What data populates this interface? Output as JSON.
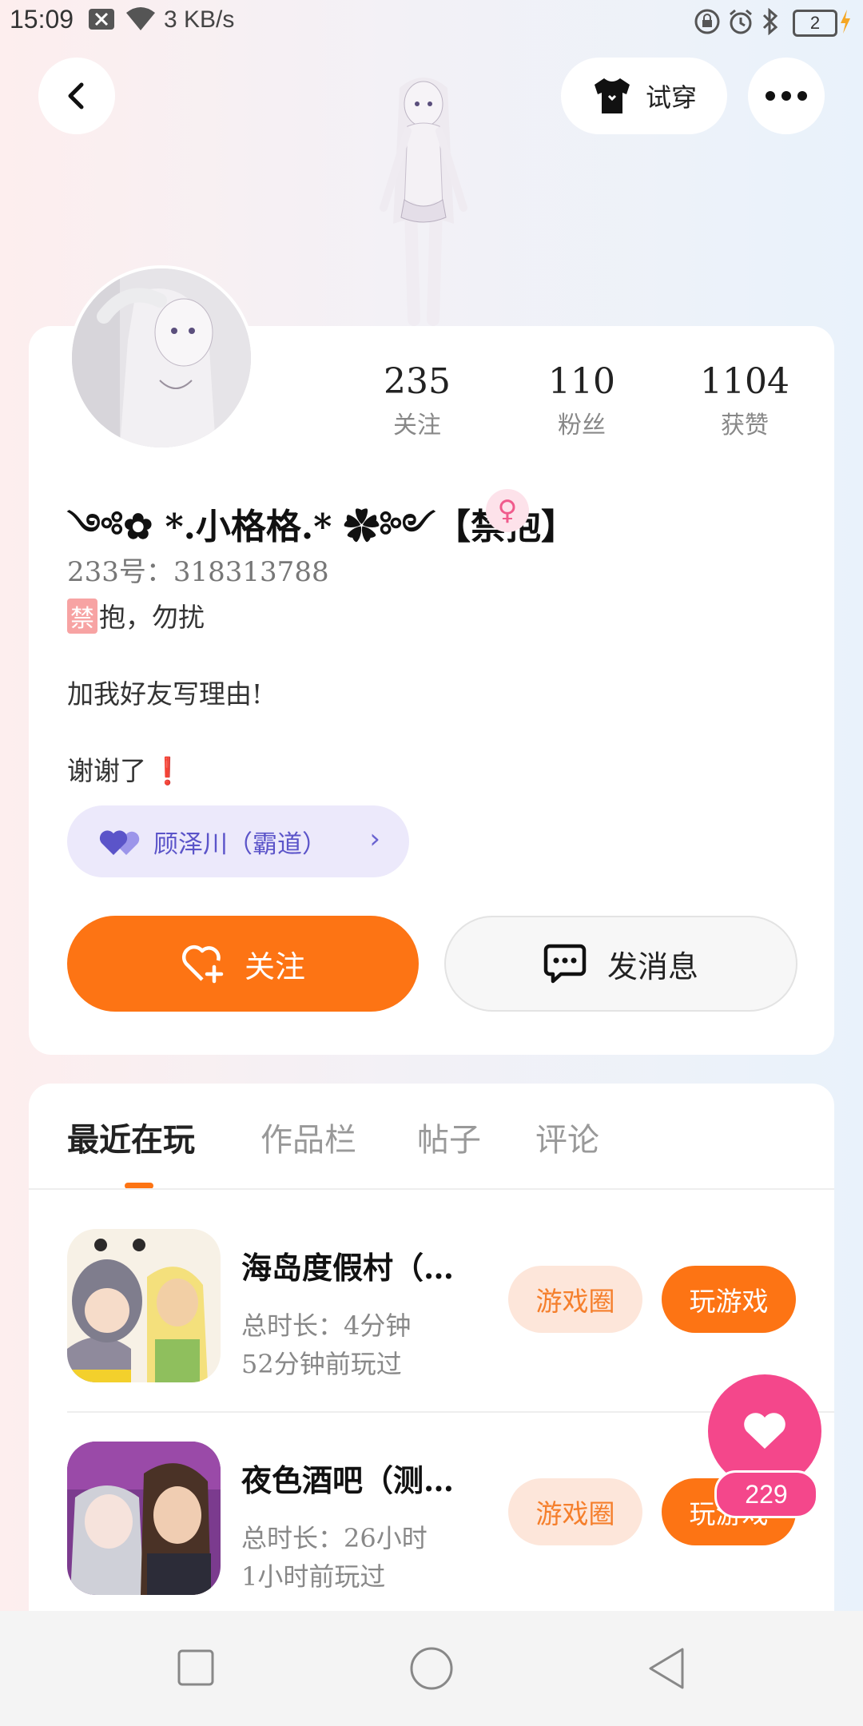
{
  "status_bar": {
    "time": "15:09",
    "network_speed": "3 KB/s",
    "battery_level": "2",
    "icons": [
      "notification-muted-icon",
      "wifi-icon",
      "lock-rotation-icon",
      "alarm-icon",
      "bluetooth-icon",
      "battery-icon",
      "charging-icon"
    ]
  },
  "header": {
    "back_icon": "chevron-left-icon",
    "tryon_label": "试穿",
    "more_icon": "more-icon"
  },
  "profile": {
    "stats": [
      {
        "value": "235",
        "label": "关注"
      },
      {
        "value": "110",
        "label": "粉丝"
      },
      {
        "value": "1104",
        "label": "获赞"
      }
    ],
    "nickname": "༺✿ *.小格格.* ✿༻【禁抱】",
    "gender_icon": "female-icon",
    "uid": "233号：318313788",
    "bio_tag": "禁",
    "bio_line1": "抱，勿扰",
    "bio_line2": "加我好友写理由!",
    "bio_line3": "谢谢了",
    "bio_emoji": "❗",
    "cp_tag": "顾泽川（霸道）",
    "follow_label": "关注",
    "message_label": "发消息"
  },
  "tabs": [
    "最近在玩",
    "作品栏",
    "帖子",
    "评论"
  ],
  "active_tab": 0,
  "games": [
    {
      "title": "海岛度假村（…",
      "duration": "总时长：4分钟",
      "last_played": "52分钟前玩过",
      "circle_label": "游戏圈",
      "play_label": "玩游戏"
    },
    {
      "title": "夜色酒吧（测…",
      "duration": "总时长：26小时",
      "last_played": "1小时前玩过",
      "circle_label": "游戏圈",
      "play_label": "玩游戏"
    }
  ],
  "like_fab": {
    "count": "229"
  },
  "colors": {
    "accent": "#fd7414",
    "pink": "#f4478b",
    "purple": "#5b54c9"
  }
}
